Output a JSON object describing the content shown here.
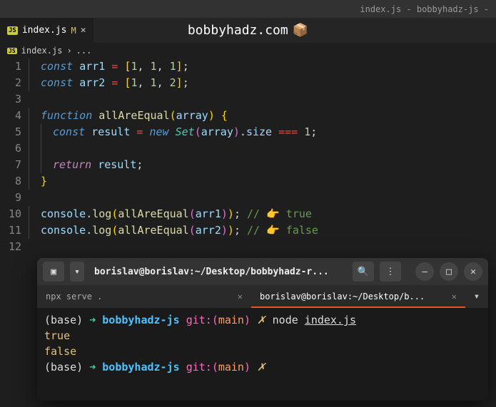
{
  "window_title": "index.js - bobbyhadz-js - ",
  "tab": {
    "badge": "JS",
    "filename": "index.js",
    "modified_marker": "M",
    "close": "✕"
  },
  "watermark": {
    "text": "bobbyhadz.com",
    "icon": "📦"
  },
  "breadcrumb": {
    "badge": "JS",
    "file": "index.js",
    "sep": "›",
    "more": "..."
  },
  "lines": [
    "1",
    "2",
    "3",
    "4",
    "5",
    "6",
    "7",
    "8",
    "9",
    "10",
    "11",
    "12"
  ],
  "code": {
    "l1": {
      "const": "const",
      "arr1": "arr1",
      "eq": "=",
      "lb": "[",
      "n1": "1",
      "c": ",",
      "n2": "1",
      "n3": "1",
      "rb": "]",
      "sc": ";"
    },
    "l2": {
      "const": "const",
      "arr2": "arr2",
      "eq": "=",
      "lb": "[",
      "n1": "1",
      "c": ",",
      "n2": "1",
      "n3": "2",
      "rb": "]",
      "sc": ";"
    },
    "l4": {
      "function": "function",
      "name": "allAreEqual",
      "lp": "(",
      "param": "array",
      "rp": ")",
      "lb": "{"
    },
    "l5": {
      "const": "const",
      "result": "result",
      "eq": "=",
      "new": "new",
      "Set": "Set",
      "lp": "(",
      "array": "array",
      "rp": ")",
      "dot": ".",
      "size": "size",
      "eqeq": "===",
      "one": "1",
      "sc": ";"
    },
    "l7": {
      "return": "return",
      "result": "result",
      "sc": ";"
    },
    "l8": {
      "rb": "}"
    },
    "l10": {
      "console": "console",
      "dot": ".",
      "log": "log",
      "lp": "(",
      "fn": "allAreEqual",
      "lp2": "(",
      "arr": "arr1",
      "rp2": ")",
      "rp": ")",
      "sc": ";",
      "com": "// 👉️ true"
    },
    "l11": {
      "console": "console",
      "dot": ".",
      "log": "log",
      "lp": "(",
      "fn": "allAreEqual",
      "lp2": "(",
      "arr": "arr2",
      "rp2": ")",
      "rp": ")",
      "sc": ";",
      "com": "// 👉️ false"
    }
  },
  "terminal": {
    "title": "borislav@borislav:~/Desktop/bobbyhadz-r...",
    "btn_newtab": "▣",
    "btn_dropdown": "▾",
    "btn_search": "🔍",
    "btn_menu": "⋮",
    "btn_min": "–",
    "btn_max": "□",
    "btn_close": "✕",
    "tabs": [
      {
        "label": "npx serve .",
        "close": "✕"
      },
      {
        "label": "borislav@borislav:~/Desktop/b...",
        "close": "✕"
      }
    ],
    "tab_dropdown": "▾",
    "out": {
      "p1": {
        "base": "(base)",
        "arrow": "➜",
        "dir": "bobbyhadz-js",
        "git": "git:",
        "lp": "(",
        "branch": "main",
        "rp": ")",
        "x": "✗",
        "cmd": "node",
        "file": "index.js"
      },
      "l2": "true",
      "l3": "false",
      "p2": {
        "base": "(base)",
        "arrow": "➜",
        "dir": "bobbyhadz-js",
        "git": "git:",
        "lp": "(",
        "branch": "main",
        "rp": ")",
        "x": "✗"
      }
    }
  }
}
